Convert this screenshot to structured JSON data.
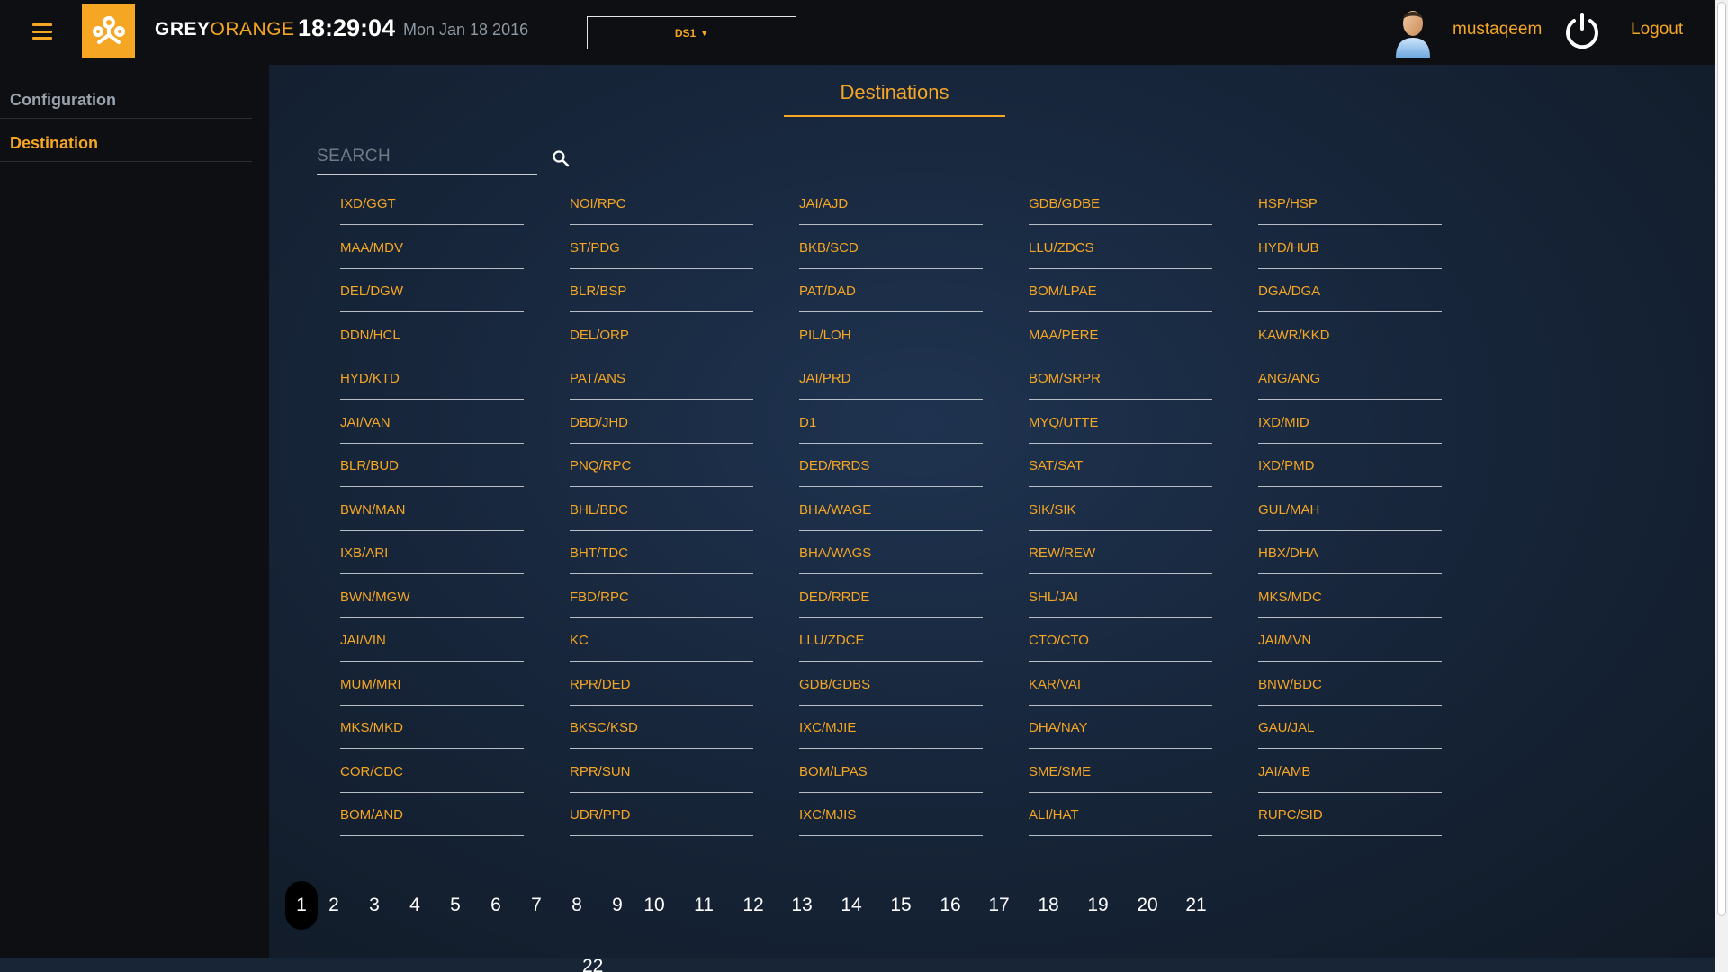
{
  "header": {
    "brand_grey": "GREY",
    "brand_orange": "ORANGE",
    "time": "18:29:04",
    "date": "Mon Jan 18 2016",
    "ds_select": "DS1",
    "username": "mustaqeem",
    "logout": "Logout",
    "icons": [
      "hamburger-menu-icon",
      "greyorange-logo-icon",
      "user-avatar-icon",
      "power-icon",
      "caret-down-icon"
    ]
  },
  "sidebar": {
    "items": [
      {
        "label": "Configuration"
      },
      {
        "label": "Destination",
        "active": true
      }
    ]
  },
  "main": {
    "title": "Destinations",
    "search_placeholder": "SEARCH",
    "destinations": [
      [
        "IXD/GGT",
        "NOI/RPC",
        "JAI/AJD",
        "GDB/GDBE",
        "HSP/HSP"
      ],
      [
        "MAA/MDV",
        "ST/PDG",
        "BKB/SCD",
        "LLU/ZDCS",
        "HYD/HUB"
      ],
      [
        "DEL/DGW",
        "BLR/BSP",
        "PAT/DAD",
        "BOM/LPAE",
        "DGA/DGA"
      ],
      [
        "DDN/HCL",
        "DEL/ORP",
        "PIL/LOH",
        "MAA/PERE",
        "KAWR/KKD"
      ],
      [
        "HYD/KTD",
        "PAT/ANS",
        "JAI/PRD",
        "BOM/SRPR",
        "ANG/ANG"
      ],
      [
        "JAI/VAN",
        "DBD/JHD",
        "D1",
        "MYQ/UTTE",
        "IXD/MID"
      ],
      [
        "BLR/BUD",
        "PNQ/RPC",
        "DED/RRDS",
        "SAT/SAT",
        "IXD/PMD"
      ],
      [
        "BWN/MAN",
        "BHL/BDC",
        "BHA/WAGE",
        "SIK/SIK",
        "GUL/MAH"
      ],
      [
        "IXB/ARI",
        "BHT/TDC",
        "BHA/WAGS",
        "REW/REW",
        "HBX/DHA"
      ],
      [
        "BWN/MGW",
        "FBD/RPC",
        "DED/RRDE",
        "SHL/JAI",
        "MKS/MDC"
      ],
      [
        "JAI/VIN",
        "KC",
        "LLU/ZDCE",
        "CTO/CTO",
        "JAI/MVN"
      ],
      [
        "MUM/MRI",
        "RPR/DED",
        "GDB/GDBS",
        "KAR/VAI",
        "BNW/BDC"
      ],
      [
        "MKS/MKD",
        "BKSC/KSD",
        "IXC/MJIE",
        "DHA/NAY",
        "GAU/JAL"
      ],
      [
        "COR/CDC",
        "RPR/SUN",
        "BOM/LPAS",
        "SME/SME",
        "JAI/AMB"
      ],
      [
        "BOM/AND",
        "UDR/PPD",
        "IXC/MJIS",
        "ALI/HAT",
        "RUPC/SID"
      ]
    ],
    "pagination": {
      "current": 1,
      "pages": [
        "1",
        "2",
        "3",
        "4",
        "5",
        "6",
        "7",
        "8",
        "9",
        "10",
        "11",
        "12",
        "13",
        "14",
        "15",
        "16",
        "17",
        "18",
        "19",
        "20",
        "21",
        "22"
      ]
    }
  }
}
